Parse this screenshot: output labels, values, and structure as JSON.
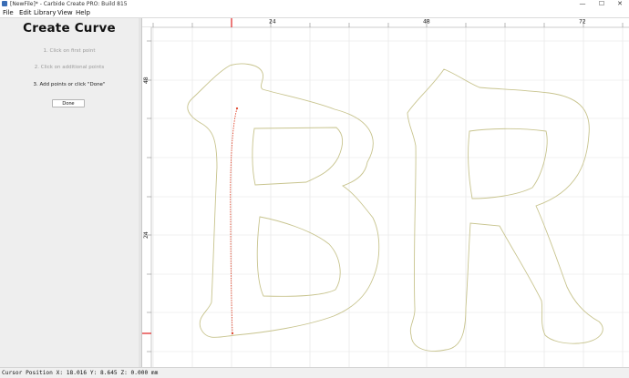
{
  "window": {
    "title": "[NewFile]* - Carbide Create PRO: Build 815",
    "controls": {
      "minimize": "—",
      "maximize": "☐",
      "close": "✕"
    }
  },
  "menu": [
    "File",
    "Edit",
    "Library",
    "View",
    "Help"
  ],
  "panel": {
    "title": "Create Curve",
    "steps": [
      "1. Click on first point",
      "2. Click on additional points",
      "3. Add points or click \"Done\""
    ],
    "active_step": 3,
    "done_label": "Done"
  },
  "rulers": {
    "top_labels": [
      "24",
      "48",
      "72"
    ],
    "left_labels": [
      "48",
      "24"
    ]
  },
  "status": {
    "text": "Cursor Position X: 18.016 Y: 8.645 Z: 0.000 mm"
  },
  "colors": {
    "outline": "#c8c48e",
    "curve": "#e0442a",
    "marker": "#e02020",
    "grid": "#e3e3e3"
  }
}
